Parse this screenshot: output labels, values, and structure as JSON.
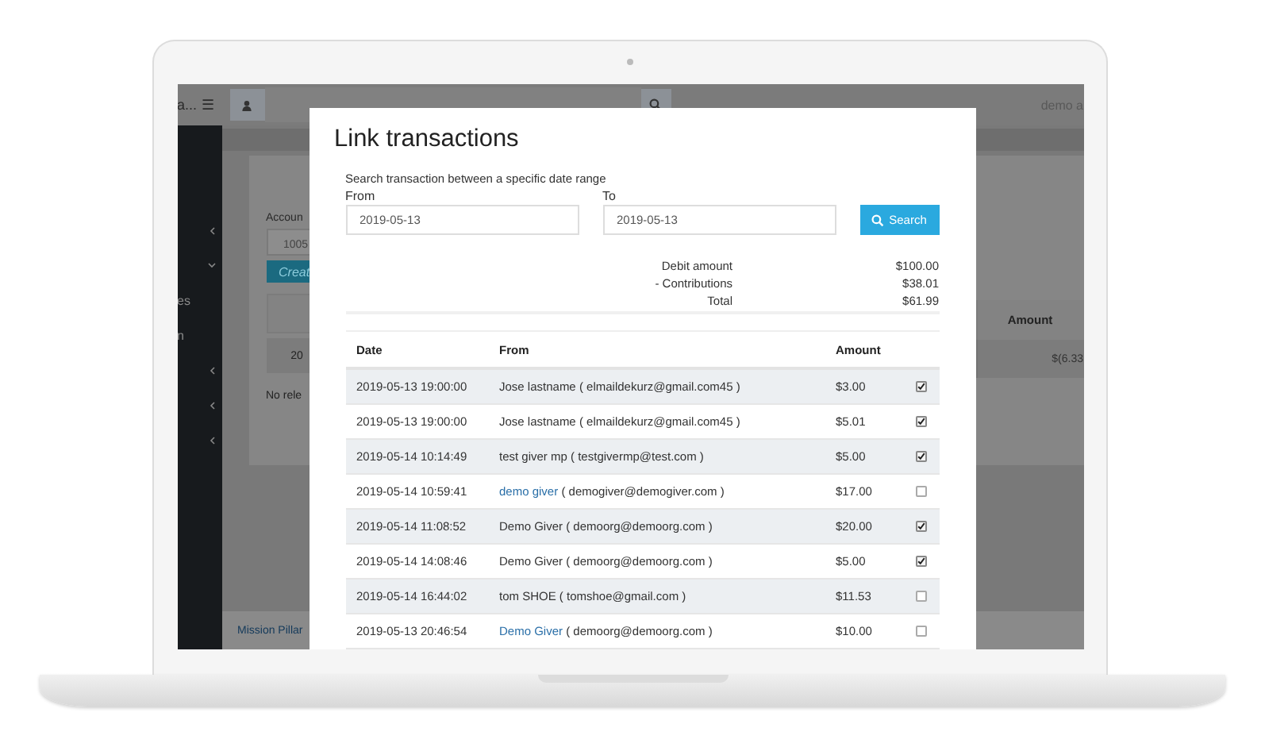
{
  "background_app": {
    "brand": "a...",
    "menu_icon": "☰",
    "user": "demo a",
    "sidebar": {
      "items": [
        {
          "kind": "group",
          "expanded": false
        },
        {
          "kind": "group",
          "expanded": true
        },
        {
          "kind": "link",
          "label": "es"
        },
        {
          "kind": "link",
          "label": "n"
        },
        {
          "kind": "group",
          "expanded": false
        },
        {
          "kind": "group",
          "expanded": false
        },
        {
          "kind": "group",
          "expanded": false
        }
      ]
    },
    "card": {
      "account_label": "Accoun",
      "account_value": "1005",
      "create_button": "Creat",
      "table_column": "Amount",
      "row_date": "20",
      "row_amount": "$(6.33",
      "empty_note": "No rele"
    },
    "footer": "Mission Pillar"
  },
  "dialog": {
    "title": "Link transactions",
    "hint": "Search transaction between a specific date range",
    "from": {
      "label": "From",
      "value": "2019-05-13"
    },
    "to": {
      "label": "To",
      "value": "2019-05-13"
    },
    "search_button": "Search",
    "summary": [
      {
        "label": "Debit amount",
        "value": "$100.00"
      },
      {
        "label": "- Contributions",
        "value": "$38.01"
      },
      {
        "label": "Total",
        "value": "$61.99"
      }
    ],
    "table": {
      "columns": [
        "Date",
        "From",
        "Amount"
      ],
      "rows": [
        {
          "date": "2019-05-13 19:00:00",
          "name": "Jose lastname",
          "contact": "( elmaildekurz@gmail.com45 )",
          "linked": false,
          "amount": "$3.00",
          "checked": true
        },
        {
          "date": "2019-05-13 19:00:00",
          "name": "Jose lastname",
          "contact": "( elmaildekurz@gmail.com45 )",
          "linked": false,
          "amount": "$5.01",
          "checked": true
        },
        {
          "date": "2019-05-14 10:14:49",
          "name": "test giver mp",
          "contact": "( testgivermp@test.com )",
          "linked": false,
          "amount": "$5.00",
          "checked": true
        },
        {
          "date": "2019-05-14 10:59:41",
          "name": "demo giver",
          "contact": "( demogiver@demogiver.com )",
          "linked": true,
          "amount": "$17.00",
          "checked": false
        },
        {
          "date": "2019-05-14 11:08:52",
          "name": "Demo Giver",
          "contact": "( demoorg@demoorg.com )",
          "linked": false,
          "amount": "$20.00",
          "checked": true
        },
        {
          "date": "2019-05-14 14:08:46",
          "name": "Demo Giver",
          "contact": "( demoorg@demoorg.com )",
          "linked": false,
          "amount": "$5.00",
          "checked": true
        },
        {
          "date": "2019-05-14 16:44:02",
          "name": "tom SHOE",
          "contact": "( tomshoe@gmail.com )",
          "linked": false,
          "amount": "$11.53",
          "checked": false
        },
        {
          "date": "2019-05-13 20:46:54",
          "name": "Demo Giver",
          "contact": "( demoorg@demoorg.com )",
          "linked": true,
          "amount": "$10.00",
          "checked": false
        }
      ]
    }
  }
}
